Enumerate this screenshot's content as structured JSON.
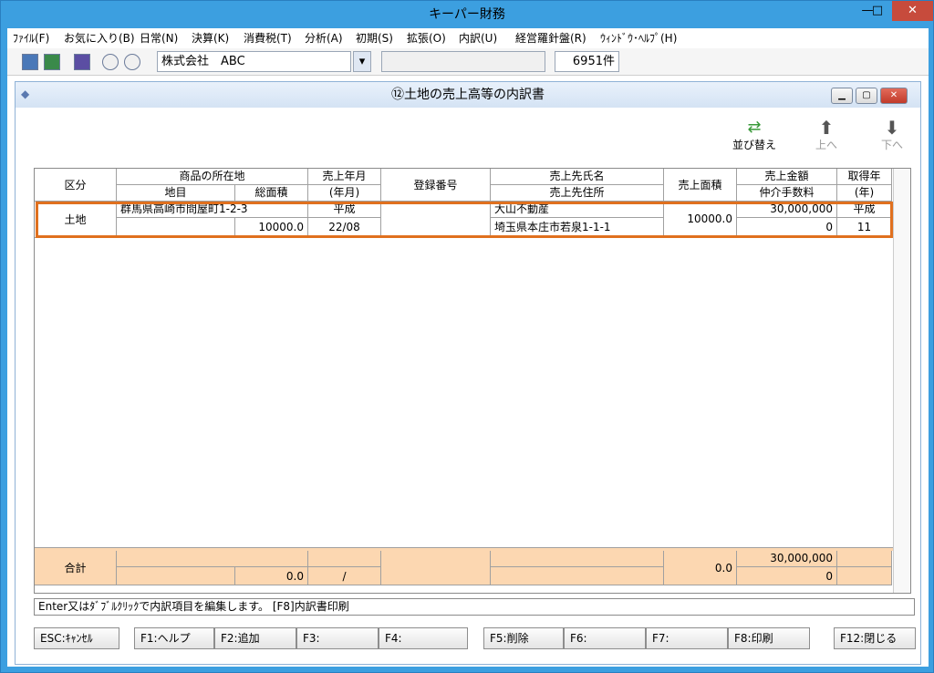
{
  "app": {
    "title": "キーパー財務",
    "min": "—",
    "max": "□",
    "close": "✕"
  },
  "menu": [
    "ﾌｧｲﾙ(F)",
    "お気に入り(B)",
    "日常(N)",
    "決算(K)",
    "消費税(T)",
    "分析(A)",
    "初期(S)",
    "拡張(O)",
    "内訳(U)",
    "経営羅針盤(R)",
    "ｳｨﾝﾄﾞｳ･ﾍﾙﾌﾟ(H)"
  ],
  "toolbar": {
    "company": "株式会社　ABC",
    "count": "6951件"
  },
  "child": {
    "title": "⑫土地の売上高等の内訳書",
    "sort": "並び替え",
    "up": "上へ",
    "down": "下へ"
  },
  "headers": {
    "kubun": "区分",
    "location": "商品の所在地",
    "chimoku": "地目",
    "area_total": "総面積",
    "sale_ym": "売上年月",
    "sale_ym_unit": "(年月)",
    "reg_no": "登録番号",
    "buyer_name": "売上先氏名",
    "buyer_addr": "売上先住所",
    "sale_area": "売上面積",
    "sale_amount": "売上金額",
    "commission": "仲介手数料",
    "acq_year": "取得年",
    "acq_year_unit": "(年)"
  },
  "rows": [
    {
      "kubun": "土地",
      "location": "群馬県高崎市問屋町1-2-3",
      "chimoku": "",
      "area_total": "10000.0",
      "sale_era": "平成",
      "sale_ym": "22/08",
      "reg_no": "",
      "buyer_name": "大山不動産",
      "buyer_addr": "埼玉県本庄市若泉1-1-1",
      "sale_area": "10000.0",
      "sale_amount": "30,000,000",
      "commission": "0",
      "acq_era": "平成",
      "acq_year": "11"
    }
  ],
  "total": {
    "label": "合計",
    "area_total": "0.0",
    "sale_ym": "/",
    "sale_area": "0.0",
    "sale_amount": "30,000,000",
    "commission": "0"
  },
  "status": "Enter又はﾀﾞﾌﾞﾙｸﾘｯｸで内訳項目を編集します。 [F8]内訳書印刷",
  "fkeys": [
    "ESC:ｷｬﾝｾﾙ",
    "F1:ヘルプ",
    "F2:追加",
    "F3:",
    "F4:",
    "F5:削除",
    "F6:",
    "F7:",
    "F8:印刷",
    "F12:閉じる"
  ]
}
